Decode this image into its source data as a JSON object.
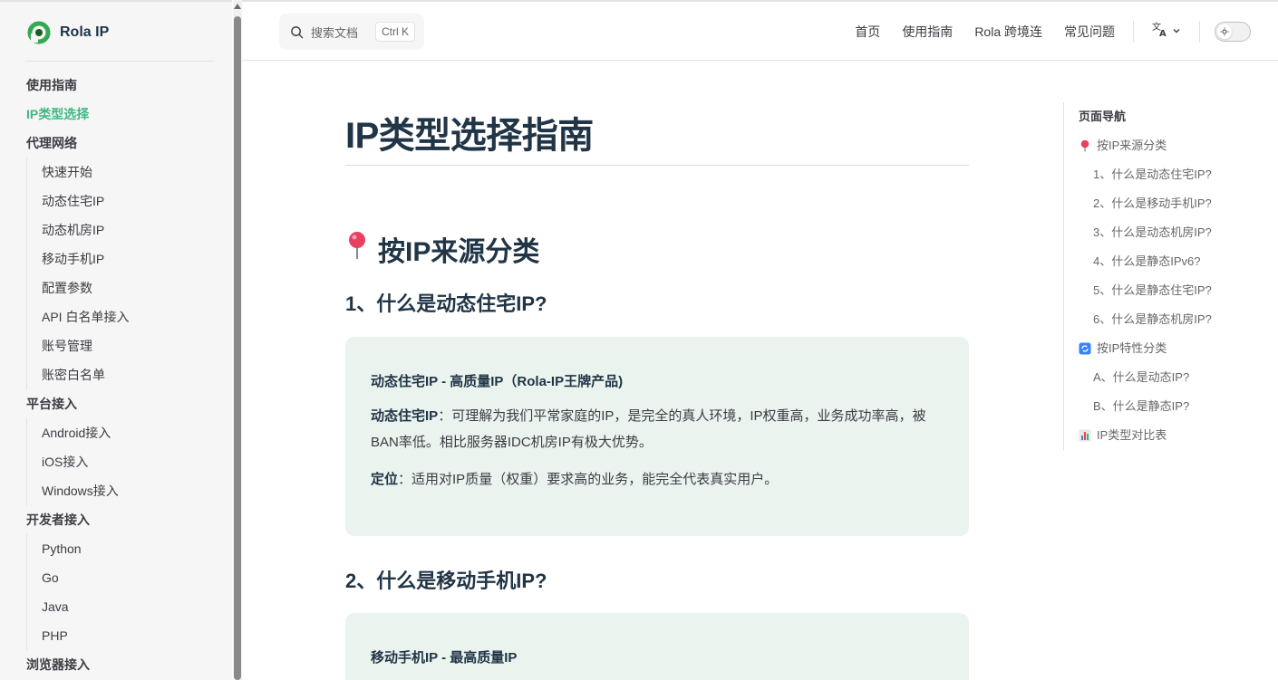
{
  "brand": {
    "name": "Rola IP",
    "accent": "#42b883"
  },
  "sidebar": {
    "items": [
      {
        "label": "使用指南",
        "kind": "top"
      },
      {
        "label": "IP类型选择",
        "kind": "active"
      },
      {
        "label": "代理网络",
        "kind": "group"
      },
      {
        "label": "快速开始",
        "kind": "sub"
      },
      {
        "label": "动态住宅IP",
        "kind": "sub"
      },
      {
        "label": "动态机房IP",
        "kind": "sub"
      },
      {
        "label": "移动手机IP",
        "kind": "sub"
      },
      {
        "label": "配置参数",
        "kind": "sub"
      },
      {
        "label": "API 白名单接入",
        "kind": "sub"
      },
      {
        "label": "账号管理",
        "kind": "sub"
      },
      {
        "label": "账密白名单",
        "kind": "sub"
      },
      {
        "label": "平台接入",
        "kind": "group"
      },
      {
        "label": "Android接入",
        "kind": "sub"
      },
      {
        "label": "iOS接入",
        "kind": "sub"
      },
      {
        "label": "Windows接入",
        "kind": "sub"
      },
      {
        "label": "开发者接入",
        "kind": "group"
      },
      {
        "label": "Python",
        "kind": "sub"
      },
      {
        "label": "Go",
        "kind": "sub"
      },
      {
        "label": "Java",
        "kind": "sub"
      },
      {
        "label": "PHP",
        "kind": "sub"
      },
      {
        "label": "浏览器接入",
        "kind": "group"
      }
    ]
  },
  "search": {
    "placeholder": "搜索文档",
    "shortcut": "Ctrl K"
  },
  "topnav": {
    "links": [
      "首页",
      "使用指南",
      "Rola 跨境连",
      "常见问题"
    ],
    "lang_icon": "translate-icon",
    "theme_icon": "sun-icon"
  },
  "main": {
    "title": "IP类型选择指南",
    "section1": {
      "emoji": "pin-icon",
      "heading": "按IP来源分类"
    },
    "h3_1": "1、什么是动态住宅IP?",
    "callout1": {
      "title": "动态住宅IP - 高质量IP（Rola-IP王牌产品)",
      "p1_label": "动态住宅IP",
      "p1_text": "：可理解为我们平常家庭的IP，是完全的真人环境，IP权重高，业务成功率高，被BAN率低。相比服务器IDC机房IP有极大优势。",
      "p2_label": "定位",
      "p2_text": "：适用对IP质量（权重）要求高的业务，能完全代表真实用户。"
    },
    "h3_2": "2、什么是移动手机IP?",
    "callout2": {
      "title": "移动手机IP - 最高质量IP"
    }
  },
  "outline": {
    "title": "页面导航",
    "items": [
      {
        "label": "按IP来源分类",
        "level": 1,
        "icon": "pin-icon"
      },
      {
        "label": "1、什么是动态住宅IP?",
        "level": 2
      },
      {
        "label": "2、什么是移动手机IP?",
        "level": 2
      },
      {
        "label": "3、什么是动态机房IP?",
        "level": 2
      },
      {
        "label": "4、什么是静态IPv6?",
        "level": 2
      },
      {
        "label": "5、什么是静态住宅IP?",
        "level": 2
      },
      {
        "label": "6、什么是静态机房IP?",
        "level": 2
      },
      {
        "label": "按IP特性分类",
        "level": 1,
        "icon": "refresh-icon"
      },
      {
        "label": "A、什么是动态IP?",
        "level": 2
      },
      {
        "label": "B、什么是静态IP?",
        "level": 2
      },
      {
        "label": "IP类型对比表",
        "level": 1,
        "icon": "bar-chart-icon"
      }
    ]
  }
}
